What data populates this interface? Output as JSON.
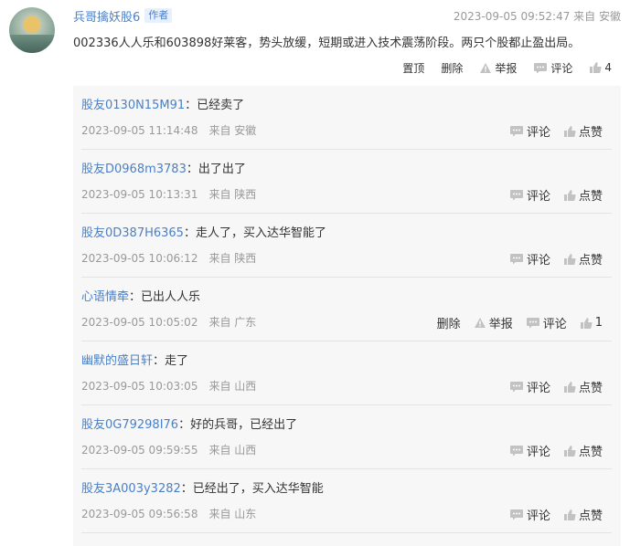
{
  "post": {
    "author": "兵哥擒妖股6",
    "author_tag": "作者",
    "time": "2023-09-05 09:52:47",
    "from": "来自 安徽",
    "content": "002336人人乐和603898好莱客，势头放缓，短期或进入技术震荡阶段。两只个股都止盈出局。",
    "actions": {
      "pin": "置顶",
      "delete": "删除",
      "report": "举报",
      "comment": "评论",
      "like_count": "4"
    }
  },
  "replies": [
    {
      "user": "股友0130N15M91",
      "text": "：已经卖了",
      "time": "2023-09-05 11:14:48",
      "from": "来自 安徽",
      "comment": "评论",
      "like": "点赞"
    },
    {
      "user": "股友D0968m3783",
      "text": "：出了出了",
      "time": "2023-09-05 10:13:31",
      "from": "来自 陕西",
      "comment": "评论",
      "like": "点赞"
    },
    {
      "user": "股友0D387H6365",
      "text": "：走人了，买入达华智能了",
      "time": "2023-09-05 10:06:12",
      "from": "来自 陕西",
      "comment": "评论",
      "like": "点赞"
    },
    {
      "user": "心语情牵",
      "text": "：已出人人乐",
      "time": "2023-09-05 10:05:02",
      "from": "来自 广东",
      "delete": "删除",
      "report": "举报",
      "comment": "评论",
      "like": "1"
    },
    {
      "user": "幽默的盛日轩",
      "text": "：走了",
      "time": "2023-09-05 10:03:05",
      "from": "来自 山西",
      "comment": "评论",
      "like": "点赞"
    },
    {
      "user": "股友0G79298I76",
      "text": "：好的兵哥，已经出了",
      "time": "2023-09-05 09:59:55",
      "from": "来自 山西",
      "comment": "评论",
      "like": "点赞"
    },
    {
      "user": "股友3A003y3282",
      "text": "：已经出了，买入达华智能",
      "time": "2023-09-05 09:56:58",
      "from": "来自 山东",
      "comment": "评论",
      "like": "点赞"
    }
  ],
  "colors": {
    "link": "#4a80c8",
    "muted": "#999999",
    "reply_bg": "#f7f7f7",
    "icon": "#c2c2c2"
  },
  "icons": [
    "warning-icon",
    "comment-icon",
    "thumbs-up-icon"
  ]
}
